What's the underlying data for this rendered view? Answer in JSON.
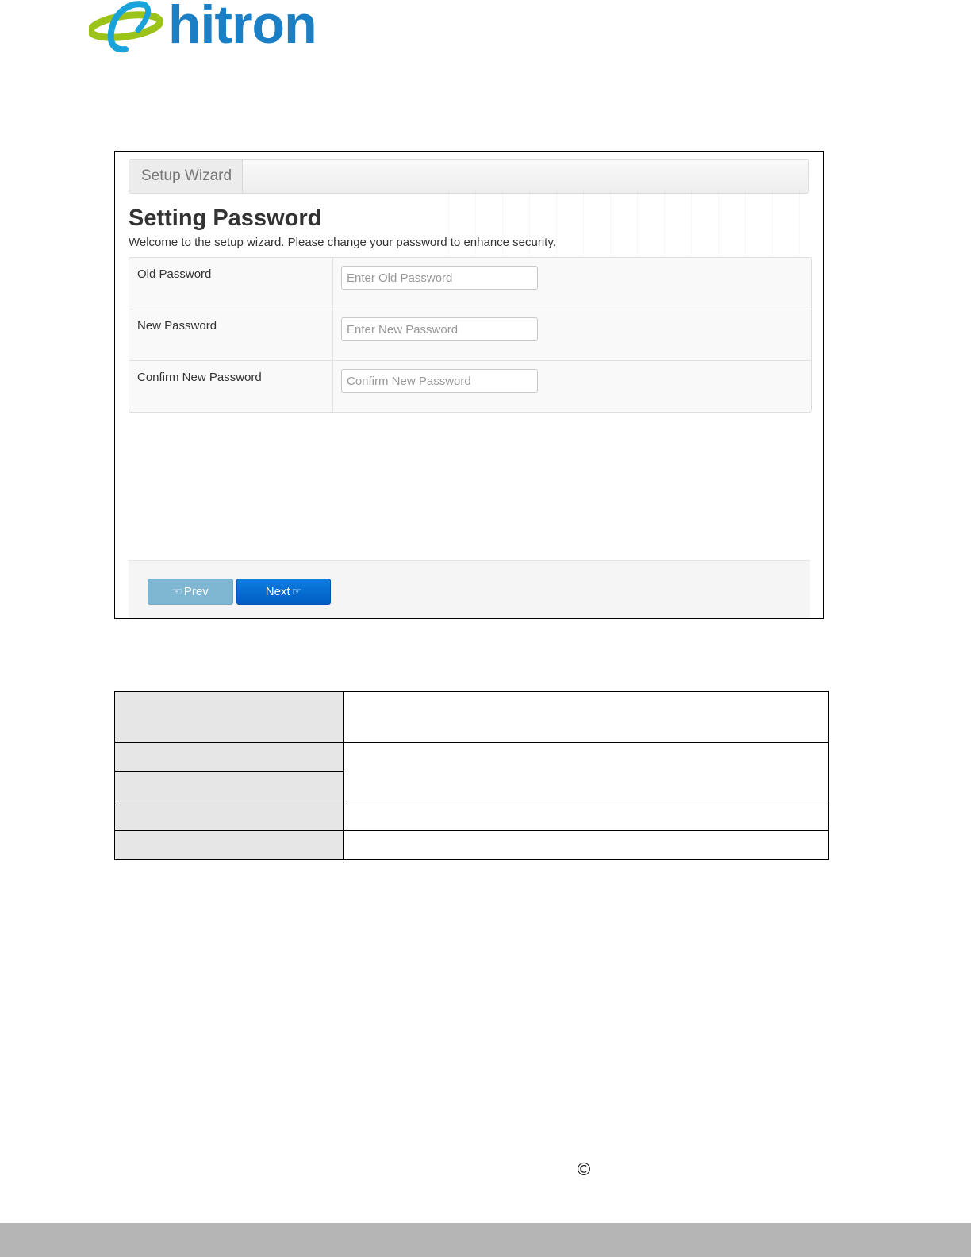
{
  "brand": {
    "name": "hitron",
    "colors": {
      "text_blue": "#1a7fc4",
      "swoosh_green": "#9cc31a",
      "swoosh_blue": "#1aa3d9"
    }
  },
  "wizard": {
    "tab_label": "Setup Wizard",
    "title": "Setting Password",
    "description": "Welcome to the setup wizard. Please change your password to enhance security.",
    "fields": [
      {
        "label": "Old Password",
        "placeholder": "Enter Old Password"
      },
      {
        "label": "New Password",
        "placeholder": "Enter New Password"
      },
      {
        "label": "Confirm New Password",
        "placeholder": "Confirm New Password"
      }
    ],
    "buttons": {
      "prev_label": "Prev",
      "prev_icon": "hand-point-left-icon",
      "next_label": "Next",
      "next_icon": "hand-point-right-icon"
    },
    "colors": {
      "next_button": "#0a6fd6",
      "prev_button": "#7fb6d1"
    }
  },
  "footer": {
    "copyright_symbol": "©"
  }
}
